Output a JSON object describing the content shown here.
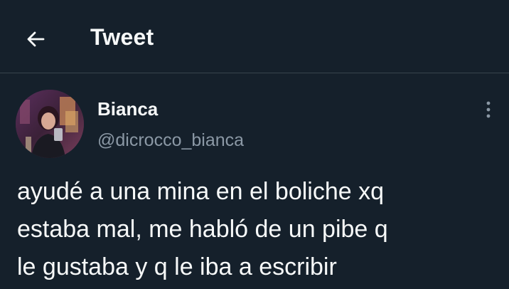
{
  "header": {
    "back_icon": "arrow-left-icon",
    "title": "Tweet"
  },
  "tweet": {
    "author": {
      "display_name": "Bianca",
      "handle": "@dicrocco_bianca",
      "avatar_icon": "avatar-photo"
    },
    "more_icon": "more-vertical-icon",
    "text_lines": [
      "ayudé a una mina en el boliche xq",
      "estaba mal, me habló de un pibe q",
      "le gustaba y q le iba a escribir"
    ]
  },
  "colors": {
    "background": "#15202b",
    "text_primary": "#f7f9f9",
    "text_secondary": "#8b98a5",
    "divider": "#38444d"
  }
}
